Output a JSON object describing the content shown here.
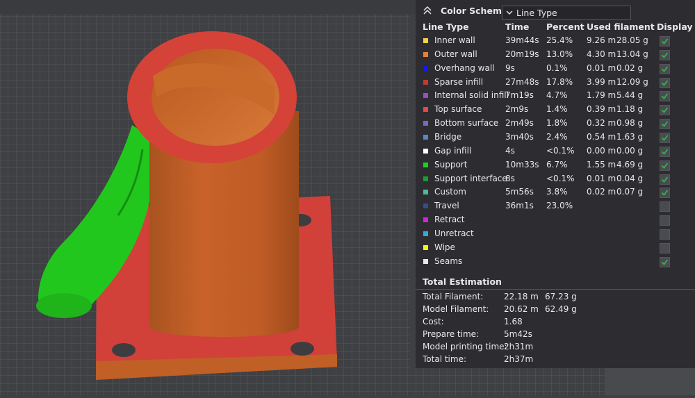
{
  "colors": {
    "panel_bg": "#2d2d31",
    "viewport_bg": "#3f4043",
    "model_orange": "#c9612a",
    "surface_red": "#d6403a",
    "support_green": "#21c61c"
  },
  "panel": {
    "title": "Color Scheme",
    "scheme_value": "Line Type",
    "headers": {
      "line_type": "Line Type",
      "time": "Time",
      "percent": "Percent",
      "used_filament": "Used filament",
      "display": "Display"
    },
    "rows": [
      {
        "color": "#f1d33d",
        "name": "Inner wall",
        "time": "39m44s",
        "percent": "25.4%",
        "m": "9.26 m",
        "g": "28.05 g",
        "checked": true
      },
      {
        "color": "#ed7f2e",
        "name": "Outer wall",
        "time": "20m19s",
        "percent": "13.0%",
        "m": "4.30 m",
        "g": "13.04 g",
        "checked": true
      },
      {
        "color": "#1717ef",
        "name": "Overhang wall",
        "time": "9s",
        "percent": "0.1%",
        "m": "0.01 m",
        "g": "0.02 g",
        "checked": true
      },
      {
        "color": "#c2392e",
        "name": "Sparse infill",
        "time": "27m48s",
        "percent": "17.8%",
        "m": "3.99 m",
        "g": "12.09 g",
        "checked": true
      },
      {
        "color": "#9a4cc4",
        "name": "Internal solid infill",
        "time": "7m19s",
        "percent": "4.7%",
        "m": "1.79 m",
        "g": "5.44 g",
        "checked": true
      },
      {
        "color": "#ea4549",
        "name": "Top surface",
        "time": "2m9s",
        "percent": "1.4%",
        "m": "0.39 m",
        "g": "1.18 g",
        "checked": true
      },
      {
        "color": "#7668c9",
        "name": "Bottom surface",
        "time": "2m49s",
        "percent": "1.8%",
        "m": "0.32 m",
        "g": "0.98 g",
        "checked": true
      },
      {
        "color": "#5a86c6",
        "name": "Bridge",
        "time": "3m40s",
        "percent": "2.4%",
        "m": "0.54 m",
        "g": "1.63 g",
        "checked": true
      },
      {
        "color": "#ffffff",
        "name": "Gap infill",
        "time": "4s",
        "percent": "<0.1%",
        "m": "0.00 m",
        "g": "0.00 g",
        "checked": true
      },
      {
        "color": "#19d11b",
        "name": "Support",
        "time": "10m33s",
        "percent": "6.7%",
        "m": "1.55 m",
        "g": "4.69 g",
        "checked": true
      },
      {
        "color": "#15a02e",
        "name": "Support interface",
        "time": "8s",
        "percent": "<0.1%",
        "m": "0.01 m",
        "g": "0.04 g",
        "checked": true
      },
      {
        "color": "#4fb894",
        "name": "Custom",
        "time": "5m56s",
        "percent": "3.8%",
        "m": "0.02 m",
        "g": "0.07 g",
        "checked": true
      },
      {
        "color": "#3a4a8c",
        "name": "Travel",
        "time": "36m1s",
        "percent": "23.0%",
        "m": "",
        "g": "",
        "checked": false
      },
      {
        "color": "#d225d2",
        "name": "Retract",
        "time": "",
        "percent": "",
        "m": "",
        "g": "",
        "checked": false
      },
      {
        "color": "#38a6dd",
        "name": "Unretract",
        "time": "",
        "percent": "",
        "m": "",
        "g": "",
        "checked": false
      },
      {
        "color": "#f5f50f",
        "name": "Wipe",
        "time": "",
        "percent": "",
        "m": "",
        "g": "",
        "checked": false
      },
      {
        "color": "#e8e8e8",
        "name": "Seams",
        "time": "",
        "percent": "",
        "m": "",
        "g": "",
        "checked": true
      }
    ],
    "estimation": {
      "title": "Total Estimation",
      "items": [
        {
          "label": "Total Filament:",
          "v1": "22.18 m",
          "v2": "67.23 g"
        },
        {
          "label": "Model Filament:",
          "v1": "20.62 m",
          "v2": "62.49 g"
        },
        {
          "label": "Cost:",
          "v1": "1.68",
          "v2": ""
        },
        {
          "label": "Prepare time:",
          "v1": "5m42s",
          "v2": ""
        },
        {
          "label": "Model printing time:",
          "v1": "2h31m",
          "v2": ""
        },
        {
          "label": "Total time:",
          "v1": "2h37m",
          "v2": ""
        }
      ]
    }
  }
}
